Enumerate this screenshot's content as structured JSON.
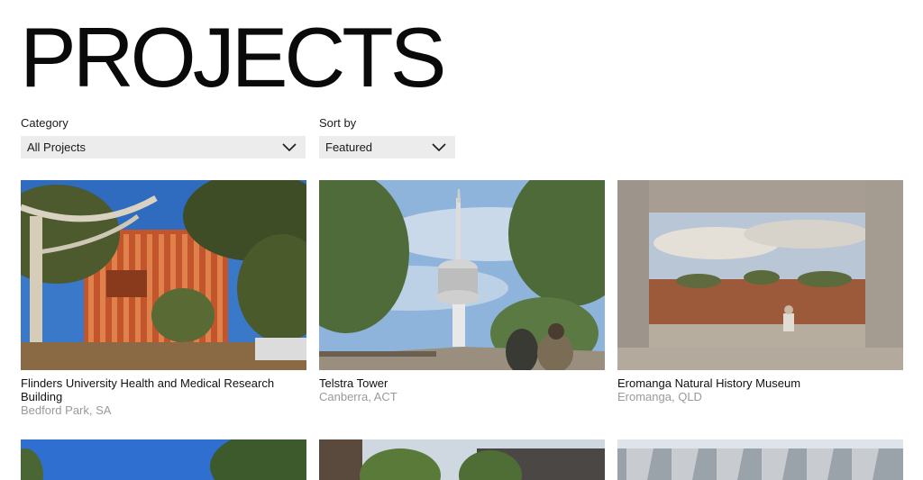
{
  "page": {
    "title": "PROJECTS"
  },
  "filters": {
    "category": {
      "label": "Category",
      "value": "All Projects"
    },
    "sort": {
      "label": "Sort by",
      "value": "Featured"
    }
  },
  "projects": [
    {
      "title": "Flinders University Health and Medical Research Building",
      "location": "Bedford Park, SA"
    },
    {
      "title": "Telstra Tower",
      "location": "Canberra, ACT"
    },
    {
      "title": "Eromanga Natural History Museum",
      "location": "Eromanga, QLD"
    }
  ],
  "colors": {
    "select_bg": "#ececec",
    "location_text": "#9a9a9a",
    "title_text": "#0a0a0a"
  }
}
